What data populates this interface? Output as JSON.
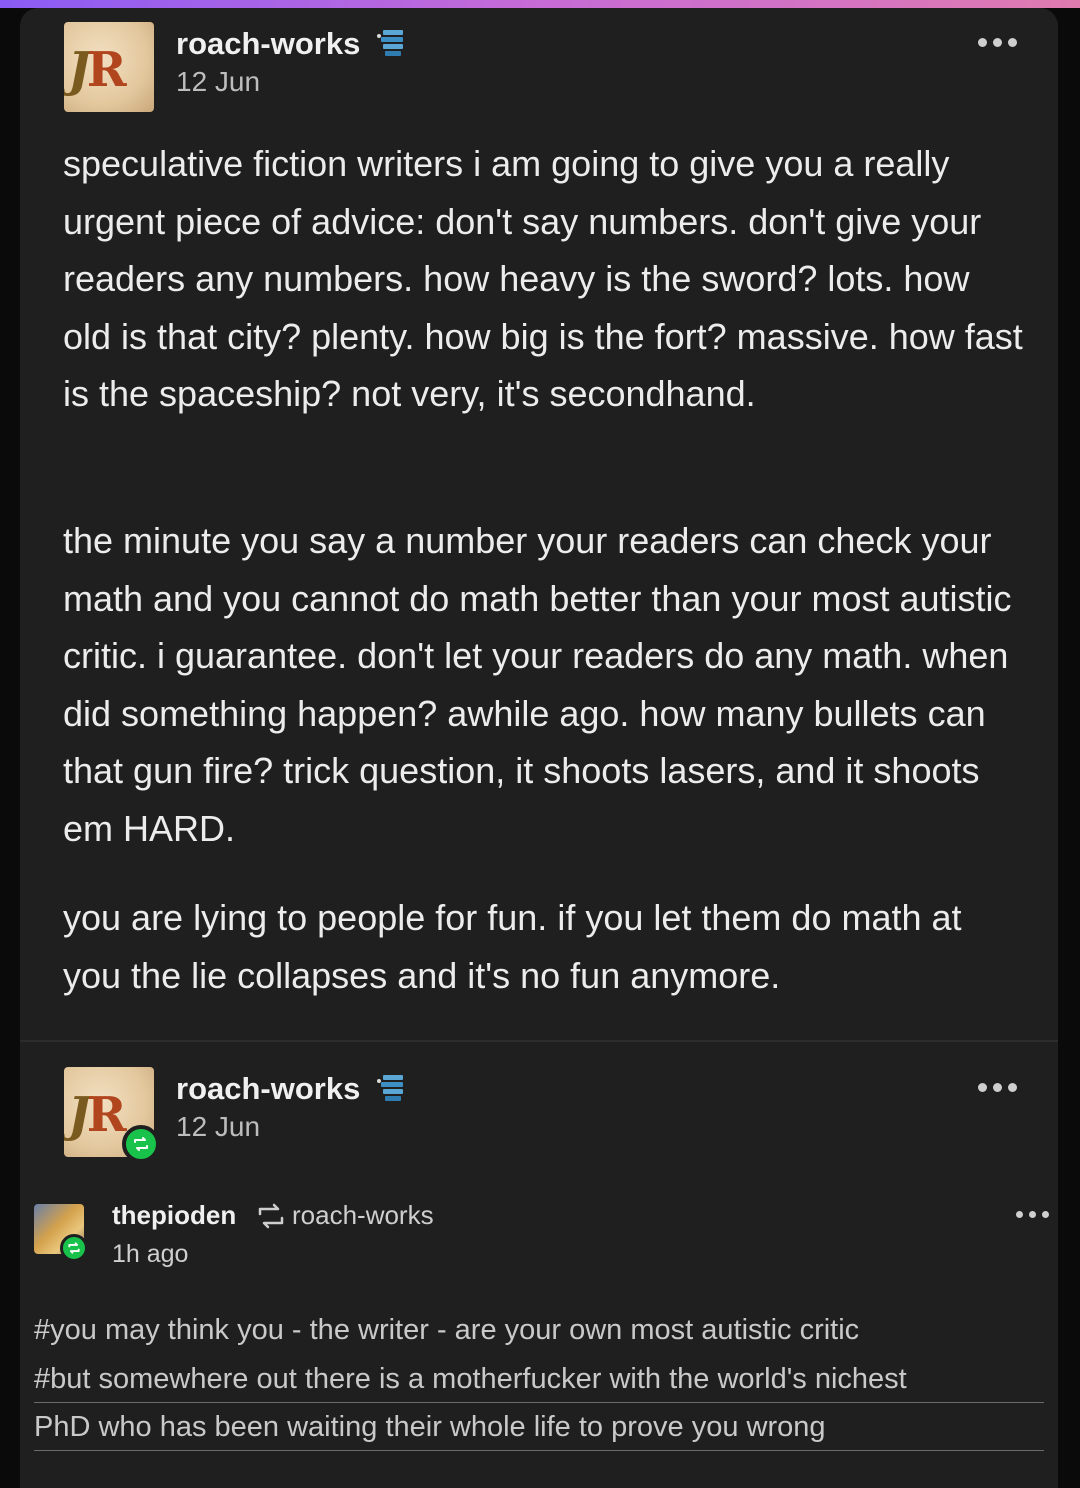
{
  "post": {
    "author": "roach-works",
    "date": "12 Jun",
    "avatar_text_j": "J",
    "avatar_text_r": "R",
    "paragraphs": [
      "speculative fiction writers i am going to give you a really urgent piece of advice: don't say numbers. don't give your readers any numbers. how heavy is the sword? lots. how old is that city? plenty. how big is the fort? massive. how fast is the spaceship? not very, it's secondhand.",
      "the minute you say a number your readers can check your math and you cannot do math better than your most autistic critic. i guarantee. don't let your readers do any math. when did something happen? awhile ago. how many bullets can that gun fire? trick question, it shoots lasers, and it shoots em HARD.",
      "you are lying to people for fun. if you let them do math at you the lie collapses and it's no fun anymore."
    ]
  },
  "reblog_header": {
    "author": "roach-works",
    "date": "12 Jun"
  },
  "reblog": {
    "user": "thepioden",
    "from": "roach-works",
    "time": "1h ago",
    "tags": [
      "#you may think you - the writer - are your own most autistic critic",
      "#but somewhere out there is a motherfucker with the world's nichest",
      "PhD who has been waiting their whole life to prove you wrong"
    ]
  },
  "icons": {
    "badge": "book-stack-icon",
    "more": "more-options-icon",
    "reblog": "reblog-icon"
  },
  "colors": {
    "card_bg": "#1f1f20",
    "reblog_green": "#19c24a",
    "accent_gradient_start": "#8a5cf5",
    "accent_gradient_end": "#e07bb0"
  }
}
